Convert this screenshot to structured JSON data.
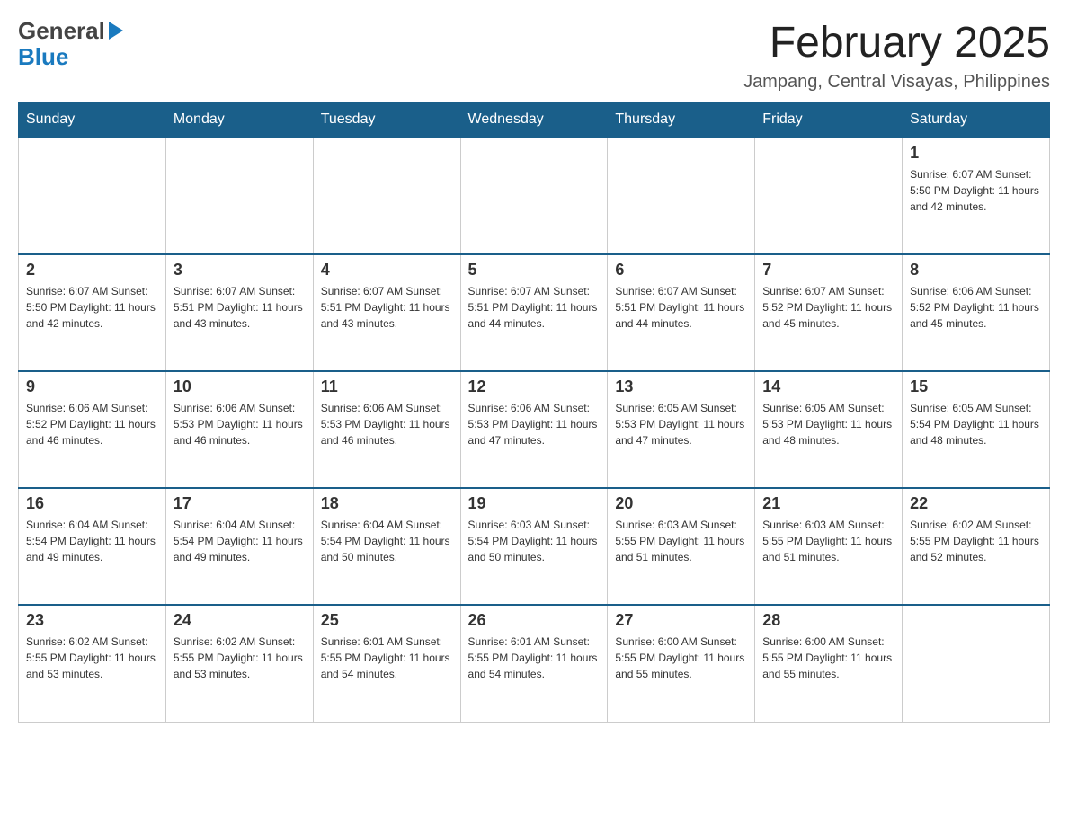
{
  "header": {
    "logo_general": "General",
    "logo_blue": "Blue",
    "month_title": "February 2025",
    "location": "Jampang, Central Visayas, Philippines"
  },
  "weekdays": [
    "Sunday",
    "Monday",
    "Tuesday",
    "Wednesday",
    "Thursday",
    "Friday",
    "Saturday"
  ],
  "weeks": [
    {
      "days": [
        {
          "date": "",
          "info": ""
        },
        {
          "date": "",
          "info": ""
        },
        {
          "date": "",
          "info": ""
        },
        {
          "date": "",
          "info": ""
        },
        {
          "date": "",
          "info": ""
        },
        {
          "date": "",
          "info": ""
        },
        {
          "date": "1",
          "info": "Sunrise: 6:07 AM\nSunset: 5:50 PM\nDaylight: 11 hours and 42 minutes."
        }
      ]
    },
    {
      "days": [
        {
          "date": "2",
          "info": "Sunrise: 6:07 AM\nSunset: 5:50 PM\nDaylight: 11 hours and 42 minutes."
        },
        {
          "date": "3",
          "info": "Sunrise: 6:07 AM\nSunset: 5:51 PM\nDaylight: 11 hours and 43 minutes."
        },
        {
          "date": "4",
          "info": "Sunrise: 6:07 AM\nSunset: 5:51 PM\nDaylight: 11 hours and 43 minutes."
        },
        {
          "date": "5",
          "info": "Sunrise: 6:07 AM\nSunset: 5:51 PM\nDaylight: 11 hours and 44 minutes."
        },
        {
          "date": "6",
          "info": "Sunrise: 6:07 AM\nSunset: 5:51 PM\nDaylight: 11 hours and 44 minutes."
        },
        {
          "date": "7",
          "info": "Sunrise: 6:07 AM\nSunset: 5:52 PM\nDaylight: 11 hours and 45 minutes."
        },
        {
          "date": "8",
          "info": "Sunrise: 6:06 AM\nSunset: 5:52 PM\nDaylight: 11 hours and 45 minutes."
        }
      ]
    },
    {
      "days": [
        {
          "date": "9",
          "info": "Sunrise: 6:06 AM\nSunset: 5:52 PM\nDaylight: 11 hours and 46 minutes."
        },
        {
          "date": "10",
          "info": "Sunrise: 6:06 AM\nSunset: 5:53 PM\nDaylight: 11 hours and 46 minutes."
        },
        {
          "date": "11",
          "info": "Sunrise: 6:06 AM\nSunset: 5:53 PM\nDaylight: 11 hours and 46 minutes."
        },
        {
          "date": "12",
          "info": "Sunrise: 6:06 AM\nSunset: 5:53 PM\nDaylight: 11 hours and 47 minutes."
        },
        {
          "date": "13",
          "info": "Sunrise: 6:05 AM\nSunset: 5:53 PM\nDaylight: 11 hours and 47 minutes."
        },
        {
          "date": "14",
          "info": "Sunrise: 6:05 AM\nSunset: 5:53 PM\nDaylight: 11 hours and 48 minutes."
        },
        {
          "date": "15",
          "info": "Sunrise: 6:05 AM\nSunset: 5:54 PM\nDaylight: 11 hours and 48 minutes."
        }
      ]
    },
    {
      "days": [
        {
          "date": "16",
          "info": "Sunrise: 6:04 AM\nSunset: 5:54 PM\nDaylight: 11 hours and 49 minutes."
        },
        {
          "date": "17",
          "info": "Sunrise: 6:04 AM\nSunset: 5:54 PM\nDaylight: 11 hours and 49 minutes."
        },
        {
          "date": "18",
          "info": "Sunrise: 6:04 AM\nSunset: 5:54 PM\nDaylight: 11 hours and 50 minutes."
        },
        {
          "date": "19",
          "info": "Sunrise: 6:03 AM\nSunset: 5:54 PM\nDaylight: 11 hours and 50 minutes."
        },
        {
          "date": "20",
          "info": "Sunrise: 6:03 AM\nSunset: 5:55 PM\nDaylight: 11 hours and 51 minutes."
        },
        {
          "date": "21",
          "info": "Sunrise: 6:03 AM\nSunset: 5:55 PM\nDaylight: 11 hours and 51 minutes."
        },
        {
          "date": "22",
          "info": "Sunrise: 6:02 AM\nSunset: 5:55 PM\nDaylight: 11 hours and 52 minutes."
        }
      ]
    },
    {
      "days": [
        {
          "date": "23",
          "info": "Sunrise: 6:02 AM\nSunset: 5:55 PM\nDaylight: 11 hours and 53 minutes."
        },
        {
          "date": "24",
          "info": "Sunrise: 6:02 AM\nSunset: 5:55 PM\nDaylight: 11 hours and 53 minutes."
        },
        {
          "date": "25",
          "info": "Sunrise: 6:01 AM\nSunset: 5:55 PM\nDaylight: 11 hours and 54 minutes."
        },
        {
          "date": "26",
          "info": "Sunrise: 6:01 AM\nSunset: 5:55 PM\nDaylight: 11 hours and 54 minutes."
        },
        {
          "date": "27",
          "info": "Sunrise: 6:00 AM\nSunset: 5:55 PM\nDaylight: 11 hours and 55 minutes."
        },
        {
          "date": "28",
          "info": "Sunrise: 6:00 AM\nSunset: 5:55 PM\nDaylight: 11 hours and 55 minutes."
        },
        {
          "date": "",
          "info": ""
        }
      ]
    }
  ]
}
